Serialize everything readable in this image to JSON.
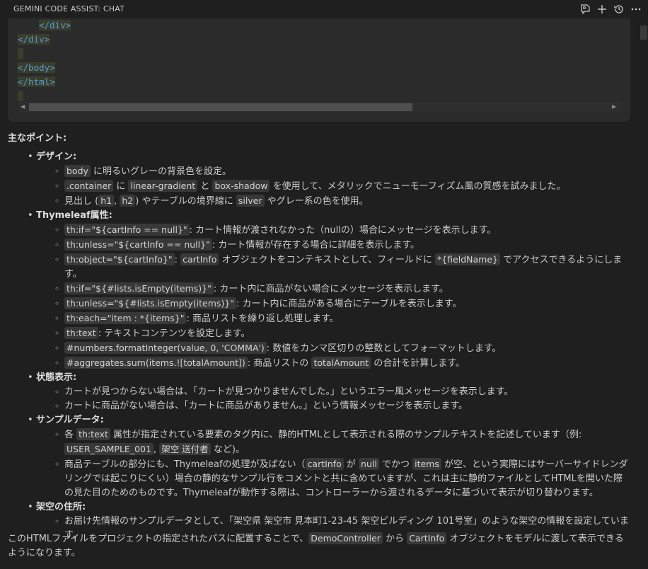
{
  "header": {
    "title": "GEMINI CODE ASSIST: CHAT",
    "icons": [
      "feedback-icon",
      "new-chat-icon",
      "history-icon",
      "more-icon"
    ]
  },
  "code": {
    "lines": [
      "    </div>",
      "</div>",
      "",
      "</body>",
      "</html>",
      ""
    ]
  },
  "section_title": "主なポイント:",
  "points": [
    {
      "title": "デザイン",
      "colon": ":",
      "items": [
        [
          {
            "c": "body"
          },
          {
            "t": " に明るいグレーの背景色を設定。"
          }
        ],
        [
          {
            "c": ".container"
          },
          {
            "t": " に "
          },
          {
            "c": "linear-gradient"
          },
          {
            "t": " と "
          },
          {
            "c": "box-shadow"
          },
          {
            "t": " を使用して、メタリックでニューモーフィズム風の質感を試みました。"
          }
        ],
        [
          {
            "t": "見出し ("
          },
          {
            "c": "h1"
          },
          {
            "t": ", "
          },
          {
            "c": "h2"
          },
          {
            "t": ") やテーブルの境界線に "
          },
          {
            "c": "silver"
          },
          {
            "t": " やグレー系の色を使用。"
          }
        ]
      ]
    },
    {
      "title": "Thymeleaf属性",
      "colon": ":",
      "items": [
        [
          {
            "c": "th:if=\"${cartInfo == null}\""
          },
          {
            "t": ": カート情報が渡されなかった（nullの）場合にメッセージを表示します。"
          }
        ],
        [
          {
            "c": "th:unless=\"${cartInfo == null}\""
          },
          {
            "t": ": カート情報が存在する場合に詳細を表示します。"
          }
        ],
        [
          {
            "c": "th:object=\"${cartInfo}\""
          },
          {
            "t": ": "
          },
          {
            "c": "cartInfo"
          },
          {
            "t": " オブジェクトをコンテキストとして、フィールドに "
          },
          {
            "c": "*{fieldName}"
          },
          {
            "t": " でアクセスできるようにします。"
          }
        ],
        [
          {
            "c": "th:if=\"${#lists.isEmpty(items)}\""
          },
          {
            "t": ": カート内に商品がない場合にメッセージを表示します。"
          }
        ],
        [
          {
            "c": "th:unless=\"${#lists.isEmpty(items)}\""
          },
          {
            "t": ": カート内に商品がある場合にテーブルを表示します。"
          }
        ],
        [
          {
            "c": "th:each=\"item : *{items}\""
          },
          {
            "t": ": 商品リストを繰り返し処理します。"
          }
        ],
        [
          {
            "c": "th:text"
          },
          {
            "t": ": テキストコンテンツを設定します。"
          }
        ],
        [
          {
            "c": "#numbers.formatInteger(value, 0, 'COMMA')"
          },
          {
            "t": ": 数値をカンマ区切りの整数としてフォーマットします。"
          }
        ],
        [
          {
            "c": "#aggregates.sum(items.![totalAmount])"
          },
          {
            "t": ": 商品リストの "
          },
          {
            "c": "totalAmount"
          },
          {
            "t": " の合計を計算します。"
          }
        ]
      ]
    },
    {
      "title": "状態表示",
      "colon": ":",
      "items": [
        [
          {
            "t": "カートが見つからない場合は、「カートが見つかりませんでした。」というエラー風メッセージを表示します。"
          }
        ],
        [
          {
            "t": "カートに商品がない場合は、「カートに商品がありません。」という情報メッセージを表示します。"
          }
        ]
      ]
    },
    {
      "title": "サンプルデータ",
      "colon": ":",
      "items": [
        [
          {
            "t": "各 "
          },
          {
            "c": "th:text"
          },
          {
            "t": " 属性が指定されている要素のタグ内に、静的HTMLとして表示される際のサンプルテキストを記述しています（例: "
          },
          {
            "c": "USER_SAMPLE_001"
          },
          {
            "t": ", "
          },
          {
            "c": "架空 送付者"
          },
          {
            "t": " など)。"
          }
        ],
        [
          {
            "t": "商品テーブルの部分にも、Thymeleafの処理が及ばない（"
          },
          {
            "c": "cartInfo"
          },
          {
            "t": " が "
          },
          {
            "c": "null"
          },
          {
            "t": " でかつ "
          },
          {
            "c": "items"
          },
          {
            "t": " が空、という実際にはサーバーサイドレンダリングでは起こりにくい）場合の静的なサンプル行をコメントと共に含めていますが、これは主に静的ファイルとしてHTMLを開いた際の見た目のためのものです。Thymeleafが動作する際は、コントローラーから渡されるデータに基づいて表示が切り替わります。"
          }
        ]
      ]
    },
    {
      "title": "架空の住所",
      "colon": ":",
      "items": [
        [
          {
            "t": "お届け先情報のサンプルデータとして、「架空県 架空市 見本町1-23-45 架空ビルディング 101号室」のような架空の情報を設定しています。"
          }
        ]
      ]
    }
  ],
  "closing": [
    {
      "t": "このHTMLファイルをプロジェクトの指定されたパスに配置することで、"
    },
    {
      "c": "DemoController"
    },
    {
      "t": " から "
    },
    {
      "c": "CartInfo"
    },
    {
      "t": " オブジェクトをモデルに渡して表示できるようになります。"
    }
  ]
}
